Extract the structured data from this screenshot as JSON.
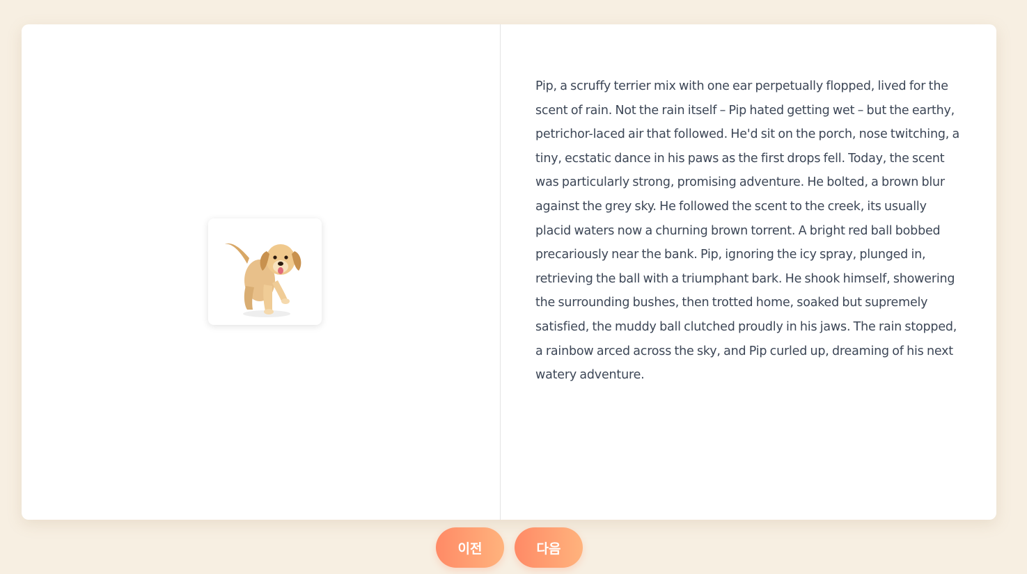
{
  "story": {
    "illustration": {
      "icon": "puppy-illustration",
      "description_hidden": ""
    },
    "text": "Pip, a scruffy terrier mix with one ear perpetually flopped, lived for the scent of rain.  Not the rain itself – Pip hated getting wet – but the earthy, petrichor-laced air that followed. He'd sit on the porch, nose twitching, a tiny, ecstatic dance in his paws as the first drops fell. Today, the scent was particularly strong, promising adventure. He bolted, a brown blur against the grey sky.  He followed the scent to the creek, its usually placid waters now a churning brown torrent.  A bright red ball bobbed precariously near the bank.  Pip, ignoring the icy spray, plunged in, retrieving the ball with a triumphant bark.  He shook himself, showering the surrounding bushes, then trotted home, soaked but supremely satisfied, the muddy ball clutched proudly in his jaws. The rain stopped, a rainbow arced across the sky, and Pip curled up, dreaming of his next watery adventure."
  },
  "navigation": {
    "prev_label": "이전",
    "next_label": "다음"
  },
  "colors": {
    "background": "#f7efe2",
    "text": "#3c4656",
    "button_gradient_start": "#ff8a66",
    "button_gradient_end": "#ffb37d"
  }
}
